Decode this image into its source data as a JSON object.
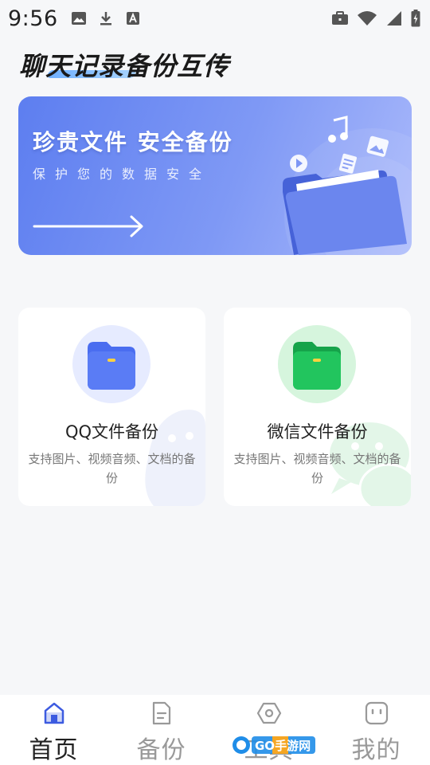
{
  "status_bar": {
    "time": "9:56",
    "left_icons": [
      "image-icon",
      "download-icon",
      "font-icon"
    ],
    "right_icons": [
      "briefcase-icon",
      "wifi-icon",
      "signal-icon",
      "battery-icon"
    ]
  },
  "app_title": "聊天记录备份互传",
  "banner": {
    "title": "珍贵文件  安全备份",
    "subtitle": "保护您的数据安全",
    "accent_colors": [
      "#5d7ef0",
      "#aab9fb"
    ]
  },
  "cards": [
    {
      "title": "QQ文件备份",
      "description": "支持图片、视频音频、文档的备份",
      "icon": "qq-folder-icon",
      "color": "#4a6df0"
    },
    {
      "title": "微信文件备份",
      "description": "支持图片、视频音频、文档的备份",
      "icon": "wechat-folder-icon",
      "color": "#22c55e"
    }
  ],
  "bottom_nav": [
    {
      "label": "首页",
      "icon": "home-icon",
      "active": true
    },
    {
      "label": "备份",
      "icon": "document-icon",
      "active": false
    },
    {
      "label": "工具",
      "icon": "hexagon-icon",
      "active": false
    },
    {
      "label": "我的",
      "icon": "profile-icon",
      "active": false
    }
  ],
  "watermark": {
    "text": "GO手游网"
  }
}
